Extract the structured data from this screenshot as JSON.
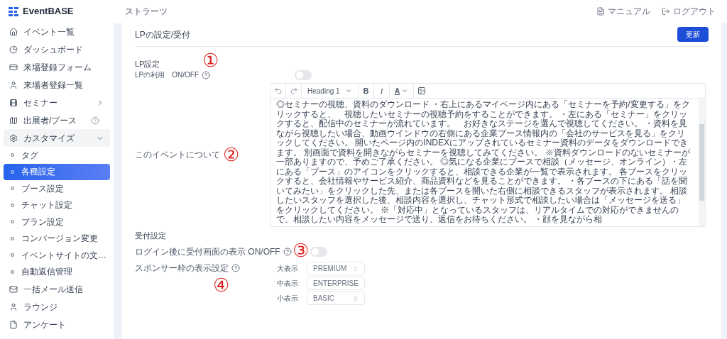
{
  "logo": "EventBASE",
  "header": {
    "title": "ストラーツ",
    "links": [
      "マニュアル",
      "ログアウト"
    ]
  },
  "sidebar": {
    "items": [
      {
        "label": "イベント一覧",
        "kind": "main",
        "selected": false
      },
      {
        "label": "ダッシュボード",
        "kind": "main",
        "selected": false
      },
      {
        "label": "来場登録フォーム",
        "kind": "main",
        "selected": false
      },
      {
        "label": "来場者登録一覧",
        "kind": "main",
        "selected": false
      },
      {
        "label": "セミナー",
        "kind": "group",
        "selected": false,
        "expanded": false
      },
      {
        "label": "出展者/ブース",
        "kind": "main",
        "selected": false,
        "help": true
      },
      {
        "label": "カスタマイズ",
        "kind": "group",
        "selected": false,
        "expanded": true
      },
      {
        "label": "タグ",
        "kind": "sub",
        "selected": false
      },
      {
        "label": "各種設定",
        "kind": "sub",
        "selected": true
      },
      {
        "label": "ブース設定",
        "kind": "sub",
        "selected": false
      },
      {
        "label": "チャット設定",
        "kind": "sub",
        "selected": false
      },
      {
        "label": "プラン設定",
        "kind": "sub",
        "selected": false
      },
      {
        "label": "コンバージョン変更",
        "kind": "sub",
        "selected": false
      },
      {
        "label": "イベントサイトの文…",
        "kind": "sub",
        "selected": false
      },
      {
        "label": "自動返信管理",
        "kind": "sub",
        "selected": false
      },
      {
        "label": "一括メール送信",
        "kind": "main",
        "selected": false
      },
      {
        "label": "ラウンジ",
        "kind": "main",
        "selected": false
      },
      {
        "label": "アンケート",
        "kind": "main",
        "selected": false
      }
    ]
  },
  "page": {
    "title": "LPの設定/受付",
    "update_button": "更新"
  },
  "lp_section": {
    "title": "LP設定",
    "marker": "①",
    "toggle": {
      "label": "LPの利用　ON/OFF",
      "on": false
    },
    "about": {
      "label": "このイベントについて",
      "marker": "②",
      "toolbar": {
        "heading": "Heading 1",
        "bold": "B",
        "italic": "I",
        "text_color_button": "A"
      },
      "text": "◎セミナーの視聴、資料のダウンロード ・右上にあるマイページ内にある「セミナーを予約/変更する」をクリックすると、　視聴したいセミナーの視聴予約をすることができます。 ・左にある「セミナー」をクリックすると、配信中のセミナーが流れています。　お好きなステージを選んで視聴してください。 ・資料を見ながら視聴したい場合、動画ウインドウの右側にある企業ブース情報内の「会社のサービスを見る」をクリックしてください。 開いたページ内のINDEXにアップされているセミナー資料のデータをダウンロードできます。 別画面で資料を開きながらセミナーを視聴してみてください。 ※資料ダウンロードのないセミナーが一部ありますので、予めご了承ください。 ◎気になる企業にブースで相談（メッセージ、オンライン）・左にある「ブース」のアイコンをクリックすると、相談できる企業が一覧で表示されます。 各ブースをクリックすると、会社情報やサービス紹介、商品資料などを見ることができます。 ・各ブースの下にある「話を聞いてみたい」をクリックした先、または各ブースを開いた右側に相談できるスタッフが表示されます。 相談したいスタッフを選択した後、相談内容を選択し、チャット形式で相談したい場合は「メッセージを送る」をクリックしてください。 ※「対応中」となっているスタッフは、リアルタイムでの対応ができませんので、相談したい内容をメッセージで送り、返信をお待ちください。 ・顔を見ながら相"
    }
  },
  "reception": {
    "title": "受付設定",
    "login_toggle": {
      "label": "ログイン後に受付画面の表示 ON/OFF",
      "marker": "③",
      "on": false
    },
    "sponsor": {
      "label": "スポンサー枠の表示設定",
      "marker": "④",
      "selects": [
        {
          "label": "大表示",
          "value": "PREMIUM"
        },
        {
          "label": "中表示",
          "value": "ENTERPRISE"
        },
        {
          "label": "小表示",
          "value": "BASIC"
        }
      ]
    }
  }
}
